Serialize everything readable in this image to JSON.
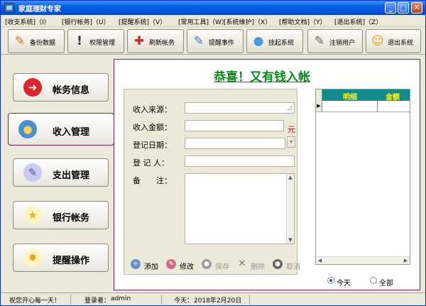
{
  "window": {
    "title": "家庭理财专家",
    "min": "_",
    "max": "□",
    "close": "✕"
  },
  "menu": [
    {
      "label": "[收支系统]（I）"
    },
    {
      "label": "[银行帐务]（U）"
    },
    {
      "label": "[提醒系统]（V）"
    },
    {
      "label": "[常用工具]（W）"
    },
    {
      "label": "[系统维护]（X）"
    },
    {
      "label": "[帮助文档]（Y）"
    },
    {
      "label": "[退出系统]（Z）"
    }
  ],
  "toolbar": [
    {
      "label": "备份数据",
      "icon": "backup-icon",
      "glyph": "✎"
    },
    {
      "label": "权限管理",
      "icon": "permission-icon",
      "glyph": "!"
    },
    {
      "label": "刷新帐务",
      "icon": "refresh-icon",
      "glyph": "✚"
    },
    {
      "label": "提醒事件",
      "icon": "remind-icon",
      "glyph": "✎"
    },
    {
      "label": "挂起系统",
      "icon": "suspend-icon",
      "glyph": "●"
    },
    {
      "label": "注销用户",
      "icon": "logout-icon",
      "glyph": "✎"
    },
    {
      "label": "退出系统",
      "icon": "exit-icon",
      "glyph": "☺"
    }
  ],
  "nav": [
    {
      "label": "帐务信息",
      "icon": "account-info-icon",
      "glyph": "➜",
      "color": "#d9262a"
    },
    {
      "label": "收入管理",
      "icon": "income-icon",
      "glyph": "●",
      "color": "#4a8fd6",
      "active": true
    },
    {
      "label": "支出管理",
      "icon": "expense-icon",
      "glyph": "✎",
      "color": "#6a6fd0"
    },
    {
      "label": "银行帐务",
      "icon": "bank-icon",
      "glyph": "★",
      "color": "#e8b320"
    },
    {
      "label": "提醒操作",
      "icon": "remind-op-icon",
      "glyph": "✸",
      "color": "#e8b320"
    }
  ],
  "banner": "恭喜！又有钱入帐",
  "form": {
    "source_label": "收入来源：",
    "amount_label": "收入金额：",
    "amount_unit": "元",
    "date_label": "登记日期：",
    "person_label": "登 记 人：",
    "note_label": "备　　注："
  },
  "actions": [
    {
      "label": "添加",
      "icon": "add-icon",
      "disabled": false
    },
    {
      "label": "修改",
      "icon": "edit-icon",
      "disabled": false
    },
    {
      "label": "保存",
      "icon": "save-icon",
      "disabled": true
    },
    {
      "label": "删除",
      "icon": "delete-icon",
      "disabled": true
    },
    {
      "label": "取消",
      "icon": "cancel-icon",
      "disabled": true
    }
  ],
  "grid": {
    "col1": "明细",
    "col2": "金额"
  },
  "filter": {
    "today": "今天",
    "all": "全部",
    "selected": "today"
  },
  "status": {
    "greeting": "祝您开心每一天！",
    "login_label": "登录者：",
    "login_user": "admin",
    "today_label": "今天：",
    "today_date": "2018年2月20日"
  },
  "colors": {
    "accent": "#7a1e6e",
    "banner": "#0a8a1a",
    "grid_header": "#138a8c",
    "grid_header_text": "#ffff00"
  }
}
